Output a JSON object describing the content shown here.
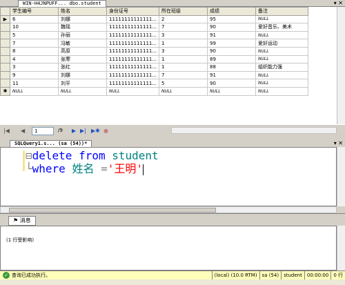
{
  "grid_tab": {
    "title": "WIN-H4JNPUFF... dbo.student"
  },
  "grid": {
    "columns": [
      "学生编号",
      "姓名",
      "身份证号",
      "所在班级",
      "成绩",
      "备注"
    ],
    "rows": [
      {
        "indicator": "▶",
        "cells": [
          "6",
          "刘娜",
          "11111111111111...",
          "2",
          "95",
          "NULL"
        ]
      },
      {
        "indicator": "",
        "cells": [
          "10",
          "魏瑶",
          "11111111111111...",
          "7",
          "90",
          "爱好音乐、美术"
        ]
      },
      {
        "indicator": "",
        "cells": [
          "5",
          "孙丽",
          "11111111111111...",
          "3",
          "91",
          "NULL"
        ]
      },
      {
        "indicator": "",
        "cells": [
          "7",
          "冯敏",
          "11111111111111...",
          "1",
          "99",
          "爱好运动"
        ]
      },
      {
        "indicator": "",
        "cells": [
          "8",
          "高原",
          "11111111111111...",
          "3",
          "90",
          "NULL"
        ]
      },
      {
        "indicator": "",
        "cells": [
          "4",
          "张寒",
          "11111111111111...",
          "1",
          "89",
          "NULL"
        ]
      },
      {
        "indicator": "",
        "cells": [
          "3",
          "张红",
          "11111111111111...",
          "1",
          "88",
          "组织能力强"
        ]
      },
      {
        "indicator": "",
        "cells": [
          "9",
          "刘娜",
          "11111111111111...",
          "7",
          "91",
          "NULL"
        ]
      },
      {
        "indicator": "",
        "cells": [
          "11",
          "刘平",
          "11111111111111...",
          "5",
          "90",
          "NULL"
        ]
      },
      {
        "indicator": "✱",
        "cells": [
          "NULL",
          "NULL",
          "NULL",
          "NULL",
          "NULL",
          "NULL"
        ]
      }
    ]
  },
  "navigator": {
    "first": "|◀",
    "prev": "◀",
    "page": "1",
    "total": "/9",
    "next": "▶",
    "last": "▶|",
    "new": "▶✱",
    "stop": "●"
  },
  "query_tab": {
    "title": "SQLQuery1.s... (sa (54))*",
    "close": "✕"
  },
  "editor": {
    "line1": {
      "kw1": "delete",
      "kw2": "from",
      "table": "student"
    },
    "line2": {
      "kw": "where",
      "col": "姓名",
      "op": "=",
      "value": "'王明'"
    }
  },
  "results_tab": {
    "icon": "⚑",
    "label": "消息"
  },
  "messages": {
    "text": "(1 行受影响)"
  },
  "status": {
    "icon": "✓",
    "message": "查询已成功执行。",
    "server": "(local) (10.0 RTM)",
    "user": "sa (54)",
    "database": "student",
    "time": "00:00:00",
    "rows": "0 行"
  },
  "window": {
    "pin": "▾",
    "close": "✕"
  }
}
